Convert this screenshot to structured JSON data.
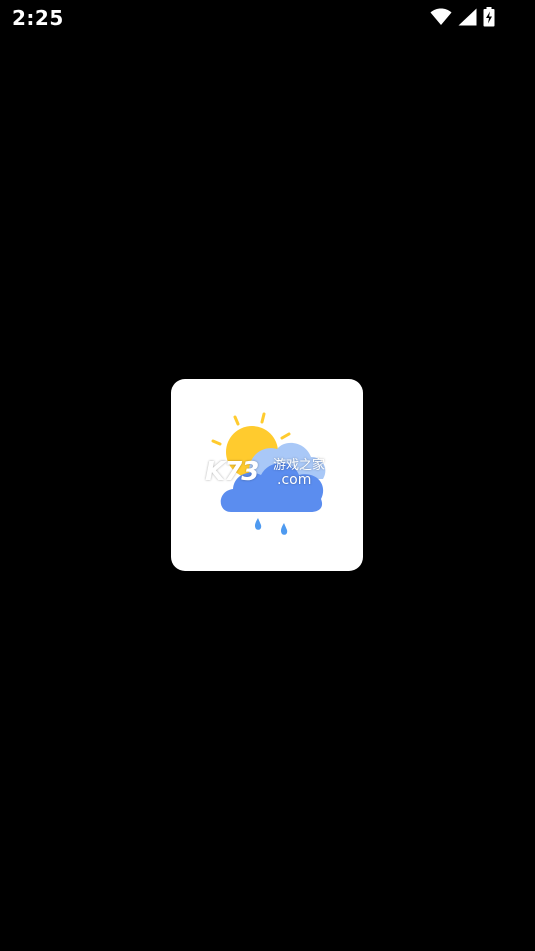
{
  "status_bar": {
    "time": "2:25",
    "icons": [
      "wifi-icon",
      "cell-signal-icon",
      "battery-charging-icon"
    ]
  },
  "splash": {
    "logo_icon": "weather-sun-cloud-rain-icon",
    "watermark": {
      "brand": "K73",
      "site_name": "游戏之家",
      "domain": ".com"
    }
  },
  "colors": {
    "background": "#000000",
    "card": "#ffffff",
    "sun": "#FFCB2E",
    "cloud_front": "#5B8DEF",
    "cloud_back": "#A9C8F7",
    "rain": "#4E9AF0"
  }
}
